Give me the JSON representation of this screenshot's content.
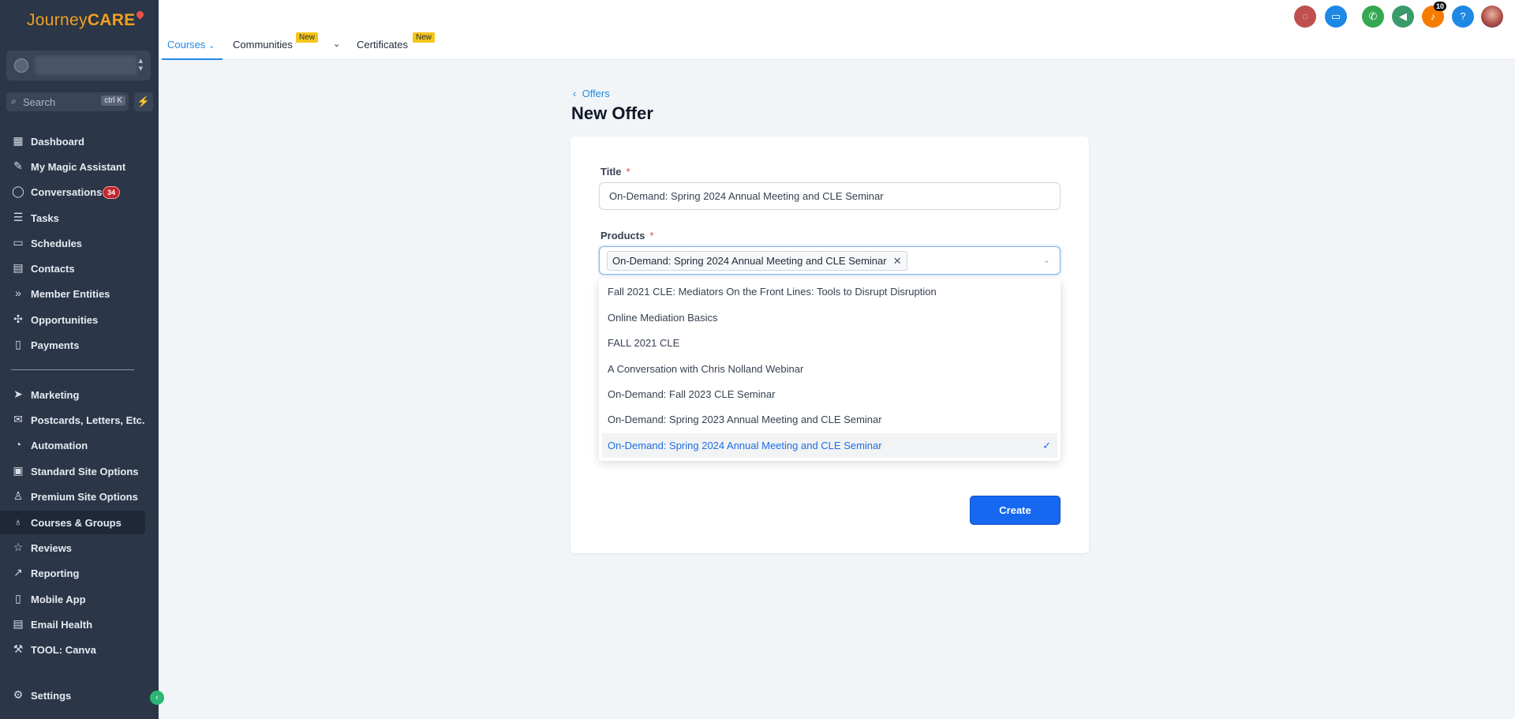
{
  "logo": {
    "part1": "Journey",
    "part2": "CARE"
  },
  "search": {
    "placeholder": "Search",
    "shortcut": "ctrl K"
  },
  "sidebar": {
    "items": [
      {
        "label": "Dashboard",
        "icon": "dashboard-icon"
      },
      {
        "label": "My Magic Assistant",
        "icon": "magic-wand-icon"
      },
      {
        "label": "Conversations",
        "icon": "chat-bubble-icon",
        "badge": "34"
      },
      {
        "label": "Tasks",
        "icon": "tasks-list-icon"
      },
      {
        "label": "Schedules",
        "icon": "calendar-icon"
      },
      {
        "label": "Contacts",
        "icon": "contacts-book-icon"
      },
      {
        "label": "Member Entities",
        "icon": "double-chevron-icon"
      },
      {
        "label": "Opportunities",
        "icon": "network-icon"
      },
      {
        "label": "Payments",
        "icon": "receipt-icon"
      },
      {
        "label": "Marketing",
        "icon": "send-icon"
      },
      {
        "label": "Postcards, Letters, Etc.",
        "icon": "mail-stack-icon"
      },
      {
        "label": "Automation",
        "icon": "automation-icon"
      },
      {
        "label": "Standard Site Options",
        "icon": "site-settings-icon"
      },
      {
        "label": "Premium Site Options",
        "icon": "premium-user-icon"
      },
      {
        "label": "Courses & Groups",
        "icon": "award-icon"
      },
      {
        "label": "Reviews",
        "icon": "star-icon"
      },
      {
        "label": "Reporting",
        "icon": "trending-up-icon"
      },
      {
        "label": "Mobile App",
        "icon": "mobile-icon"
      },
      {
        "label": "Email Health",
        "icon": "email-health-icon"
      },
      {
        "label": "TOOL: Canva",
        "icon": "wrench-icon"
      },
      {
        "label": "Settings",
        "icon": "gear-icon"
      }
    ]
  },
  "topnav": {
    "tabs": [
      {
        "label": "Courses",
        "active": true
      },
      {
        "label": "Communities",
        "badge": "New"
      },
      {
        "label": "Certificates",
        "badge": "New"
      }
    ],
    "notification_count": "10",
    "icon_colors": {
      "chat": "#c0504d",
      "contact-card": "#1e88e5",
      "phone": "#34a853",
      "megaphone": "#3a9a6a",
      "bell": "#f57c00",
      "help": "#1e88e5"
    }
  },
  "page": {
    "breadcrumb": "Offers",
    "title": "New Offer"
  },
  "form": {
    "title_label": "Title",
    "title_value": "On-Demand: Spring 2024 Annual Meeting and CLE Seminar",
    "required_mark": "*",
    "products_label": "Products",
    "selected_product": "On-Demand: Spring 2024 Annual Meeting and CLE Seminar",
    "options": [
      "Fall 2021 CLE: Mediators On the Front Lines: Tools to Disrupt Disruption",
      "Online Mediation Basics",
      "FALL 2021 CLE",
      "A Conversation with Chris Nolland Webinar",
      "On-Demand: Fall 2023 CLE Seminar",
      "On-Demand: Spring 2023 Annual Meeting and CLE Seminar",
      "On-Demand: Spring 2024 Annual Meeting and CLE Seminar"
    ],
    "create_label": "Create"
  },
  "colors": {
    "sidebar_bg": "#2b3648",
    "accent": "#1e8ae6",
    "primary_button": "#1668f0"
  }
}
